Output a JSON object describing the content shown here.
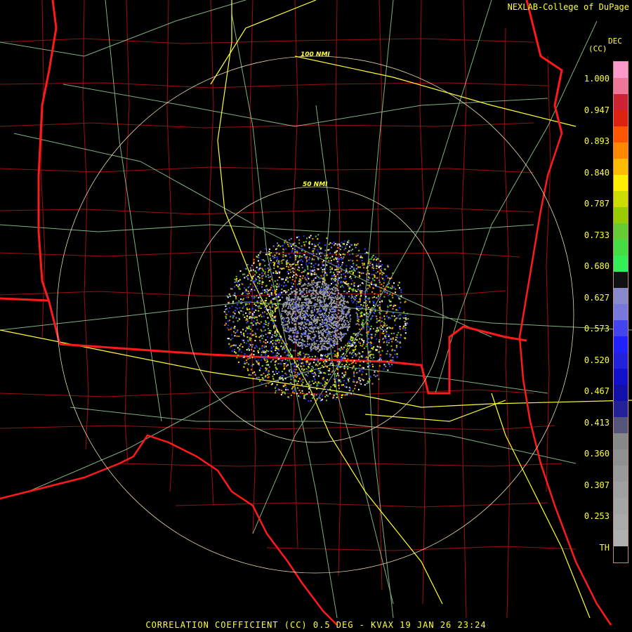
{
  "credit": "NEXLAB-College of DuPage",
  "units": {
    "line1": "DEC",
    "line2": "(CC)"
  },
  "footer": "CORRELATION COEFFICIENT (CC) 0.5 DEG - KVAX 19 JAN 26 23:24",
  "rings": [
    {
      "label": "100 NMI"
    },
    {
      "label": "50 NMI"
    }
  ],
  "scale": {
    "ticks": [
      "1.000",
      "0.947",
      "0.893",
      "0.840",
      "0.787",
      "0.733",
      "0.680",
      "0.627",
      "0.573",
      "0.520",
      "0.467",
      "0.413",
      "0.360",
      "0.307",
      "0.253",
      "TH"
    ],
    "colors": [
      "#ff99cc",
      "#ee7799",
      "#cc2233",
      "#dd2211",
      "#ff5500",
      "#ff8800",
      "#ffbb00",
      "#ffee00",
      "#ccdd00",
      "#99cc00",
      "#66cc33",
      "#44dd44",
      "#33ee55",
      "#111111",
      "#8888cc",
      "#7777dd",
      "#4444ee",
      "#2222ff",
      "#2222dd",
      "#1111cc",
      "#1111aa",
      "#222299",
      "#555577",
      "#888888",
      "#909090",
      "#999999",
      "#a0a0a0",
      "#a5a5a5",
      "#aaaaaa",
      "#b0b0b0",
      "#000000"
    ]
  },
  "colors": {
    "state_lines": "#ff1a1a",
    "county_lines": "#cc1a1a",
    "highways": "#ffff33",
    "roads": "#9fdc9f",
    "range_rings": "#ffeebb"
  }
}
